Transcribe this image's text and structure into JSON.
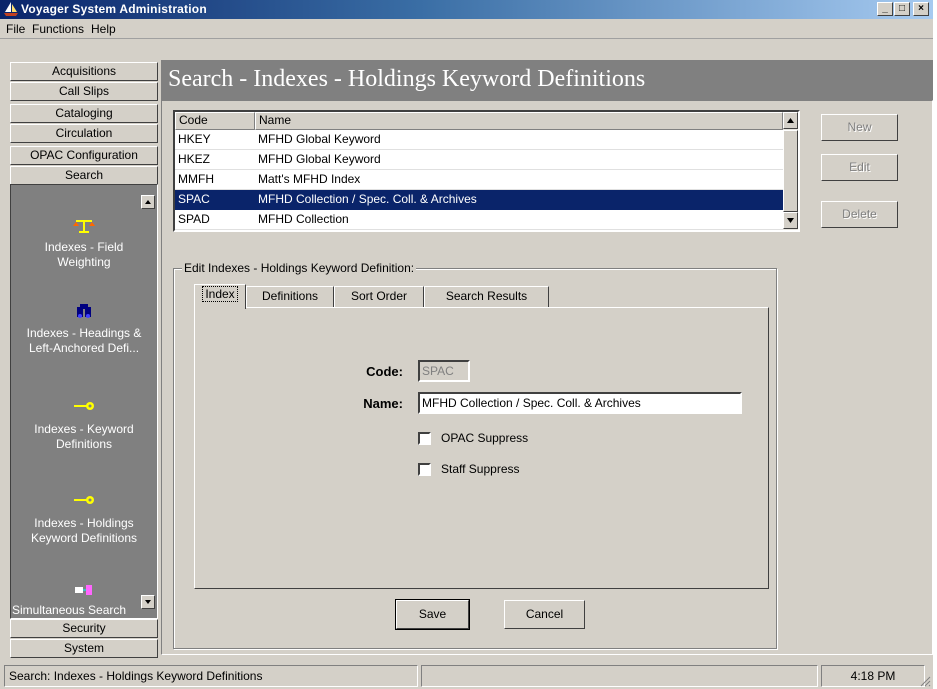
{
  "window": {
    "title": "Voyager System Administration",
    "minimize_glyph": "_",
    "maximize_glyph": "□",
    "close_glyph": "×"
  },
  "menu": [
    {
      "label": "File"
    },
    {
      "label": "Functions"
    },
    {
      "label": "Help"
    }
  ],
  "modules": {
    "acquisitions": "Acquisitions",
    "call_slips": "Call Slips",
    "cataloging": "Cataloging",
    "circulation": "Circulation",
    "opac_configuration": "OPAC Configuration",
    "search": "Search",
    "security": "Security",
    "system": "System"
  },
  "search_items": [
    {
      "label_line1": "Indexes - Field",
      "label_line2": "Weighting",
      "icon": "scales-icon"
    },
    {
      "label_line1": "Indexes - Headings &",
      "label_line2": "Left-Anchored Defi...",
      "icon": "binoculars-icon"
    },
    {
      "label_line1": "Indexes - Keyword",
      "label_line2": "Definitions",
      "icon": "key-icon"
    },
    {
      "label_line1": "Indexes - Holdings",
      "label_line2": "Keyword Definitions",
      "icon": "key-icon"
    },
    {
      "label_line1": "Simultaneous Search",
      "label_line2": "",
      "icon": "connection-icon"
    }
  ],
  "page_title": "Search - Indexes - Holdings Keyword Definitions",
  "list": {
    "columns": [
      "Code",
      "Name"
    ],
    "rows": [
      {
        "code": "HKEY",
        "name": "MFHD Global Keyword"
      },
      {
        "code": "HKEZ",
        "name": "MFHD Global Keyword"
      },
      {
        "code": "MMFH",
        "name": "Matt's MFHD Index"
      },
      {
        "code": "SPAC",
        "name": "MFHD Collection / Spec. Coll. & Archives"
      },
      {
        "code": "SPAD",
        "name": "MFHD Collection"
      }
    ],
    "selected_index": 3
  },
  "actions": {
    "new": "New",
    "edit": "Edit",
    "delete": "Delete"
  },
  "edit_group": {
    "label": "Edit  Indexes - Holdings Keyword Definition:",
    "tabs": [
      "Index",
      "Definitions",
      "Sort Order",
      "Search Results"
    ],
    "active_tab": "Index",
    "code_label": "Code:",
    "code_value": "SPAC",
    "name_label": "Name:",
    "name_value": "MFHD Collection / Spec. Coll. & Archives",
    "opac_suppress_label": "OPAC Suppress",
    "opac_suppress_checked": false,
    "staff_suppress_label": "Staff Suppress",
    "staff_suppress_checked": false,
    "save": "Save",
    "cancel": "Cancel"
  },
  "status": {
    "text": "Search:  Indexes - Holdings Keyword Definitions",
    "time": "4:18 PM"
  },
  "colors": {
    "selection": "#0a246a",
    "title_gradient_start": "#0a246a",
    "title_gradient_end": "#a6caf0",
    "nav_panel": "#808080",
    "key_icon": "#ffff00",
    "face": "#d4d0c8"
  }
}
